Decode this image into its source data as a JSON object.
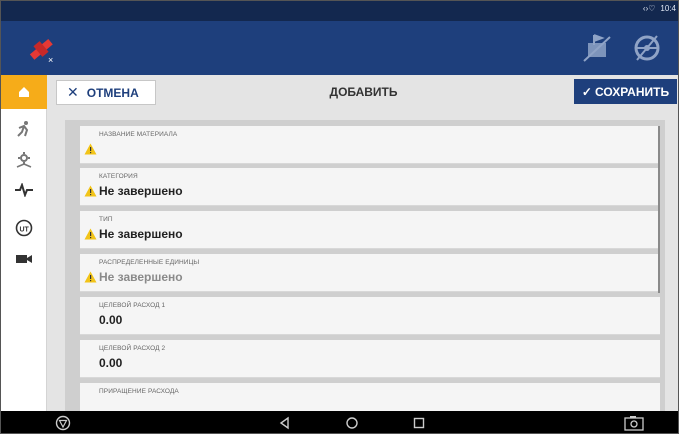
{
  "status_bar": {
    "time": "10:4",
    "signal_text": "‹›♡"
  },
  "toolbar": {
    "cancel_label": "ОТМЕНА",
    "title": "ДОБАВИТЬ",
    "save_label": "СОХРАНИТЬ",
    "save_check": "✓",
    "cancel_x": "✕"
  },
  "form": {
    "rows": [
      {
        "label": "НАЗВАНИЕ МАТЕРИАЛА",
        "value": ""
      },
      {
        "label": "КАТЕГОРИЯ",
        "value": "Не завершено"
      },
      {
        "label": "ТИП",
        "value": "Не завершено"
      },
      {
        "label": "РАСПРЕДЕЛЕННЫЕ ЕДИНИЦЫ",
        "value": "Не завершено"
      },
      {
        "label": "ЦЕЛЕВОЙ РАСХОД 1",
        "value": "0.00"
      },
      {
        "label": "ЦЕЛЕВОЙ РАСХОД 2",
        "value": "0.00"
      },
      {
        "label": "ПРИРАЩЕНИЕ РАСХОДА",
        "value": ""
      }
    ]
  },
  "colors": {
    "header": "#1e3f7c",
    "accent": "#f6ac19",
    "status": "#13284f"
  },
  "icons": {
    "app_bar": [
      "satellite-off-icon",
      "field-marker-icon",
      "steering-wheel-icon"
    ],
    "rail": [
      "home-icon",
      "operator-icon",
      "settings-icon",
      "pulse-icon",
      "ut-icon",
      "camera-icon"
    ],
    "nav": [
      "brand-icon",
      "back-icon",
      "home-circle-icon",
      "recent-square-icon",
      "screenshot-camera-icon"
    ]
  }
}
